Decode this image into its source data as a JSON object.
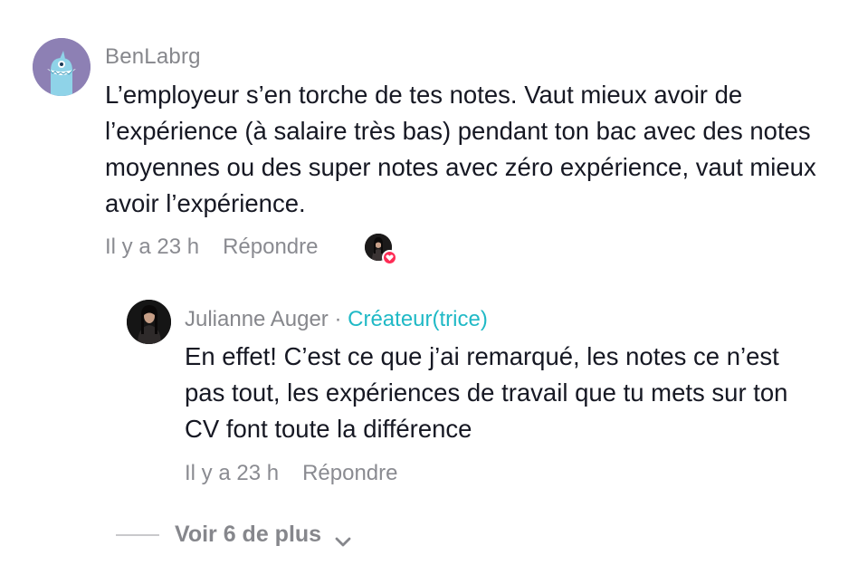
{
  "comment": {
    "username": "BenLabrg",
    "avatar_icon": "blue-monster-avatar-icon",
    "text": "L’employeur s’en torche de tes notes. Vaut mieux avoir de l’expérience (à salaire très bas) pendant ton bac avec des notes moyennes ou des super notes avec zéro expérience, vaut mieux avoir l’expérience.",
    "time": "Il y a 23 h",
    "reply_label": "Répondre",
    "liked_by_creator_icon": "heart-icon"
  },
  "reply": {
    "username": "Julianne Auger",
    "separator": " · ",
    "badge": "Créateur(trice)",
    "text": "En effet! C’est ce que j’ai remarqué, les notes ce n’est pas tout, les expériences de travail que tu mets sur ton CV font toute la différence",
    "time": "Il y a 23 h",
    "reply_label": "Répondre"
  },
  "more_replies": {
    "label": "Voir 6 de plus",
    "icon": "chevron-down-icon"
  },
  "colors": {
    "muted": "#86878c",
    "creator": "#20b9c6",
    "heart": "#fe2c55",
    "text": "#161823"
  }
}
